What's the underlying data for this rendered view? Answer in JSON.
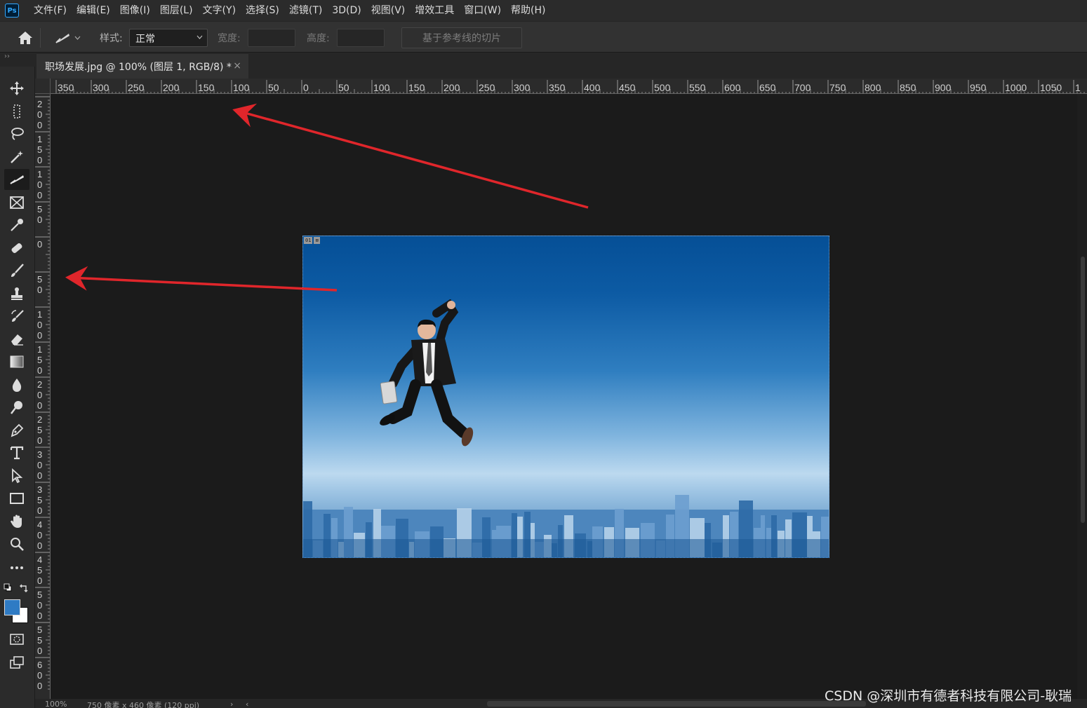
{
  "app": {
    "logo": "Ps"
  },
  "menu": [
    "文件(F)",
    "编辑(E)",
    "图像(I)",
    "图层(L)",
    "文字(Y)",
    "选择(S)",
    "滤镜(T)",
    "3D(D)",
    "视图(V)",
    "增效工具",
    "窗口(W)",
    "帮助(H)"
  ],
  "options": {
    "style_label": "样式:",
    "style_value": "正常",
    "width_label": "宽度:",
    "height_label": "高度:",
    "slice_button": "基于参考线的切片"
  },
  "collapse_glyph": "››",
  "tab": {
    "title": "职场发展.jpg @ 100% (图层 1, RGB/8) *",
    "close": "×"
  },
  "ruler_top_labels": [
    "350",
    "300",
    "250",
    "200",
    "150",
    "100",
    "50",
    "0",
    "50",
    "100",
    "150",
    "200",
    "250",
    "300",
    "350",
    "400",
    "450",
    "500",
    "550",
    "600",
    "650",
    "700",
    "750",
    "800",
    "850",
    "900",
    "950",
    "1000",
    "1050",
    "1"
  ],
  "ruler_left_labels": [
    "200",
    "150",
    "100",
    "50",
    "0",
    "50",
    "100",
    "150",
    "200",
    "250",
    "300",
    "350",
    "400",
    "450",
    "500",
    "550",
    "600"
  ],
  "image_badge": [
    "01",
    "⊠"
  ],
  "status": {
    "zoom": "100%",
    "doc_info": "750 像素 x 460 像素 (120 ppi)",
    "chevron": "›",
    "scroll_left": "‹"
  },
  "watermark": "CSDN @深圳市有德者科技有限公司-耿瑞",
  "colors": {
    "foreground": "#2f7bc4",
    "background": "#ffffff",
    "arrow": "#e0262b",
    "accent": "#31a8ff"
  },
  "tools": [
    "move-icon",
    "marquee-icon",
    "lasso-icon",
    "magic-wand-icon",
    "slice-icon",
    "frame-icon",
    "eyedropper-icon",
    "healing-icon",
    "brush-icon",
    "stamp-icon",
    "history-brush-icon",
    "eraser-icon",
    "gradient-icon",
    "blur-icon",
    "dodge-icon",
    "pen-icon",
    "type-icon",
    "path-select-icon",
    "rectangle-icon",
    "hand-icon",
    "zoom-icon",
    "more-icon"
  ]
}
